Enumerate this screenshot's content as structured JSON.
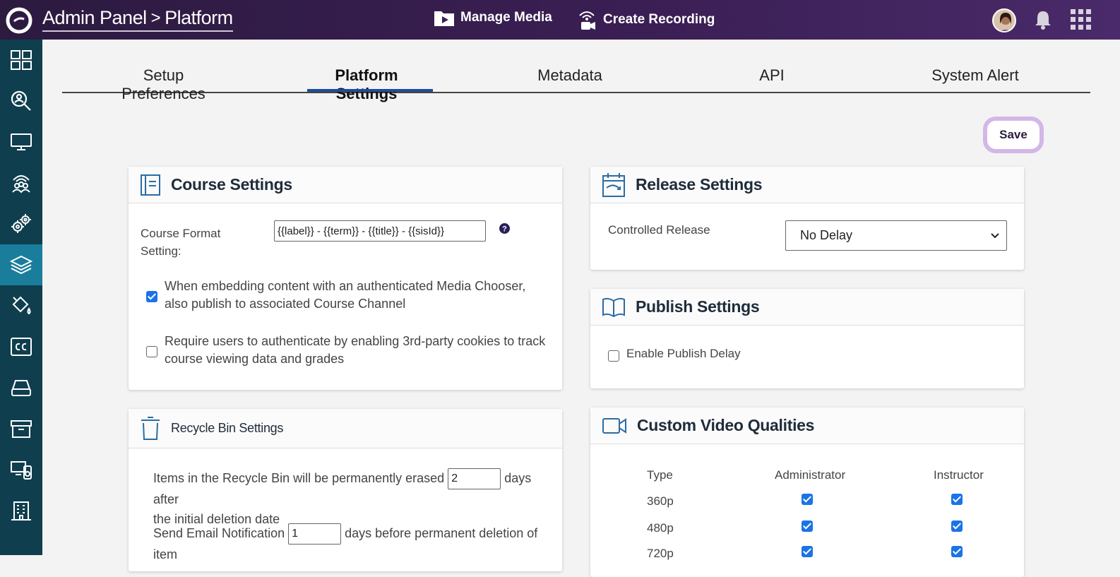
{
  "header": {
    "breadcrumb_root": "Admin Panel",
    "breadcrumb_separator": ">",
    "breadcrumb_current": "Platform",
    "nav_manage_media": "Manage Media",
    "nav_create_recording": "Create Recording"
  },
  "tabs": [
    {
      "label": "Setup Preferences"
    },
    {
      "label": "Platform Settings"
    },
    {
      "label": "Metadata"
    },
    {
      "label": "API"
    },
    {
      "label": "System Alert"
    }
  ],
  "save_label": "Save",
  "course": {
    "title": "Course Settings",
    "format_label_line1": "Course Format",
    "format_label_line2": "Setting:",
    "format_value": "{{label}} - {{term}} - {{title}} - {{sisId}}",
    "embed_label": "When embedding content with an authenticated Media Chooser, also publish to associated Course Channel",
    "cookies_label": "Require users to authenticate by enabling 3rd-party cookies to track course viewing data and grades"
  },
  "recycle": {
    "title": "Recycle Bin Settings",
    "erase_before": "Items in the Recycle Bin will be permanently erased",
    "erase_value": "2",
    "erase_after": "days after",
    "erase_line2": "the initial deletion date",
    "notify_before": "Send Email Notification",
    "notify_value": "1",
    "notify_after": "days before permanent deletion of",
    "notify_line2": "item"
  },
  "release": {
    "title": "Release Settings",
    "controlled_label": "Controlled Release",
    "controlled_value": "No Delay"
  },
  "publish": {
    "title": "Publish Settings",
    "delay_label": "Enable Publish Delay"
  },
  "video": {
    "title": "Custom Video Qualities",
    "col_type": "Type",
    "col_admin": "Administrator",
    "col_instructor": "Instructor",
    "rows": [
      {
        "type": "360p"
      },
      {
        "type": "480p"
      },
      {
        "type": "720p"
      }
    ]
  },
  "colors": {
    "topbar": "#3b1f55",
    "sidebar": "#0f3f4f",
    "sidebar_active": "#1a7d9c",
    "accent": "#1e4f95",
    "save_border": "#d3b7e8"
  }
}
